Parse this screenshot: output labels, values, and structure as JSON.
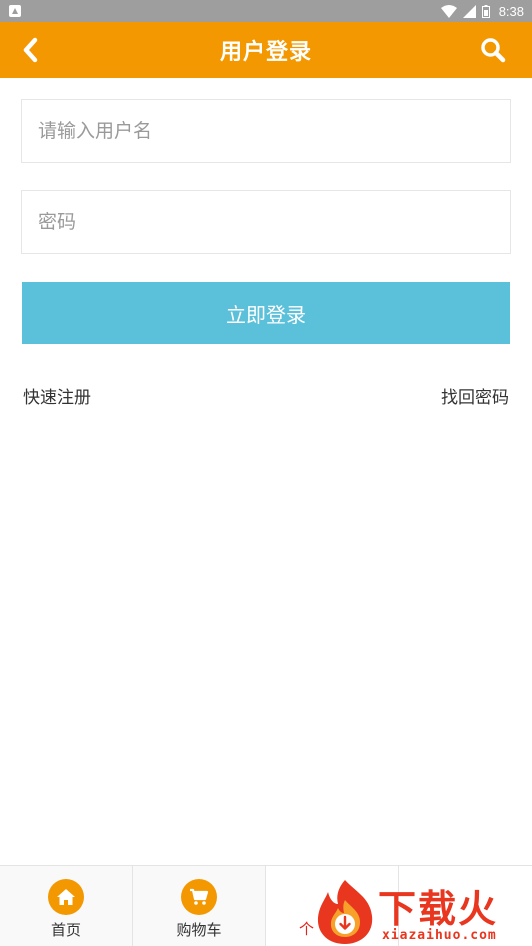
{
  "status_bar": {
    "time": "8:38",
    "icons": [
      "notification-icon",
      "wifi-icon",
      "signal-icon",
      "battery-icon"
    ]
  },
  "header": {
    "title": "用户登录",
    "back_icon": "chevron-left-icon",
    "search_icon": "search-icon",
    "background": "#f39800"
  },
  "form": {
    "username_placeholder": "请输入用户名",
    "username_value": "",
    "password_placeholder": "密码",
    "password_value": "",
    "login_label": "立即登录",
    "login_color": "#5bc0d9",
    "register_label": "快速注册",
    "forgot_label": "找回密码"
  },
  "bottom_nav": {
    "items": [
      {
        "label": "首页",
        "icon": "home-icon"
      },
      {
        "label": "购物车",
        "icon": "cart-icon"
      },
      {
        "label": "个",
        "icon": ""
      }
    ]
  },
  "watermark": {
    "text": "下载火",
    "url": "xiazaihuo.com"
  }
}
